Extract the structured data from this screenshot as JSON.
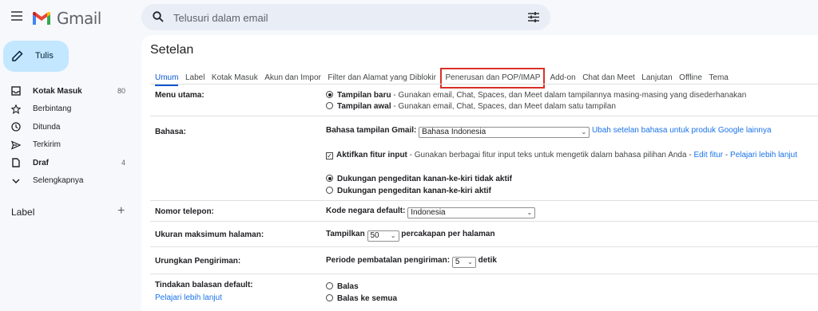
{
  "app": {
    "name": "Gmail"
  },
  "search": {
    "placeholder": "Telusuri dalam email"
  },
  "compose": {
    "label": "Tulis"
  },
  "sidebar": {
    "items": [
      {
        "label": "Kotak Masuk",
        "count": "80",
        "icon": "inbox-icon",
        "bold": true
      },
      {
        "label": "Berbintang",
        "count": "",
        "icon": "star-icon",
        "bold": false
      },
      {
        "label": "Ditunda",
        "count": "",
        "icon": "clock-icon",
        "bold": false
      },
      {
        "label": "Terkirim",
        "count": "",
        "icon": "send-icon",
        "bold": false
      },
      {
        "label": "Draf",
        "count": "4",
        "icon": "draft-icon",
        "bold": true
      },
      {
        "label": "Selengkapnya",
        "count": "",
        "icon": "chevron-down-icon",
        "bold": false
      }
    ],
    "labels_heading": "Label",
    "labels_add": "+"
  },
  "settings": {
    "title": "Setelan",
    "tabs": [
      "Umum",
      "Label",
      "Kotak Masuk",
      "Akun dan Impor",
      "Filter dan Alamat yang Diblokir",
      "Penerusan dan POP/IMAP",
      "Add-on",
      "Chat dan Meet",
      "Lanjutan",
      "Offline",
      "Tema"
    ],
    "menu": {
      "key": "Menu utama:",
      "opt1_title": "Tampilan baru",
      "opt1_desc": " - Gunakan email, Chat, Spaces, dan Meet dalam tampilannya masing-masing yang disederhanakan",
      "opt2_title": "Tampilan awal",
      "opt2_desc": " - Gunakan email, Chat, Spaces, dan Meet dalam satu tampilan"
    },
    "language": {
      "key": "Bahasa:",
      "display_label": "Bahasa tampilan Gmail:",
      "display_value": "Bahasa Indonesia",
      "change_link": "Ubah setelan bahasa untuk produk Google lainnya",
      "input_title": "Aktifkan fitur input",
      "input_desc": " - Gunakan berbagai fitur input teks untuk mengetik dalam bahasa pilihan Anda - ",
      "edit_link": "Edit fitur",
      "sep": " - ",
      "learn_link": "Pelajari lebih lanjut",
      "rtl_off": "Dukungan pengeditan kanan-ke-kiri tidak aktif",
      "rtl_on": "Dukungan pengeditan kanan-ke-kiri aktif"
    },
    "phone": {
      "key": "Nomor telepon:",
      "label": "Kode negara default:",
      "value": "Indonesia"
    },
    "page_size": {
      "key": "Ukuran maksimum halaman:",
      "prefix": "Tampilkan",
      "value": "50",
      "suffix": "percakapan per halaman"
    },
    "undo": {
      "key": "Urungkan Pengiriman:",
      "label": "Periode pembatalan pengiriman:",
      "value": "5",
      "suffix": "detik"
    },
    "reply": {
      "key": "Tindakan balasan default:",
      "link": "Pelajari lebih lanjut",
      "opt1": "Balas",
      "opt2": "Balas ke semua"
    }
  }
}
